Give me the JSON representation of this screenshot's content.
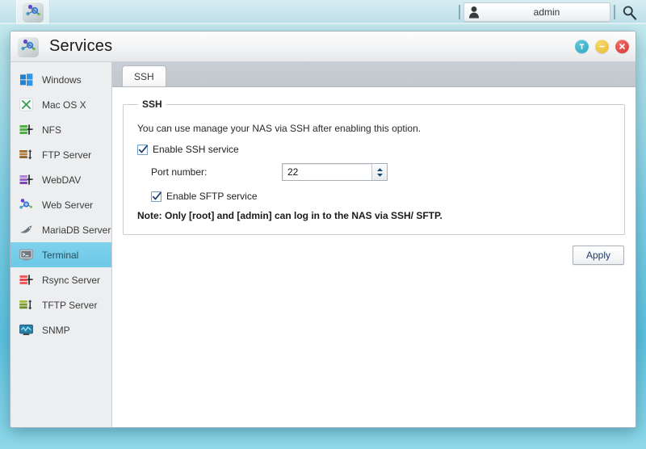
{
  "desktop": {
    "logo_icon": "molecule-logo-icon",
    "user": {
      "icon": "user-icon",
      "name": "admin"
    },
    "search_icon": "search-icon"
  },
  "window": {
    "title": "Services",
    "icon": "molecule-logo-icon",
    "controls": [
      {
        "name": "pin-button",
        "icon": "pin-icon",
        "color": "#29a9c4"
      },
      {
        "name": "minimize-button",
        "icon": "minus-icon",
        "color": "#e9bc2f"
      },
      {
        "name": "close-button",
        "icon": "close-icon",
        "color": "#d8352f"
      }
    ]
  },
  "sidebar": {
    "items": [
      {
        "label": "Windows",
        "icon": "windows-icon",
        "selected": false
      },
      {
        "label": "Mac OS X",
        "icon": "macosx-icon",
        "selected": false
      },
      {
        "label": "NFS",
        "icon": "nfs-icon",
        "selected": false
      },
      {
        "label": "FTP Server",
        "icon": "ftp-icon",
        "selected": false
      },
      {
        "label": "WebDAV",
        "icon": "webdav-icon",
        "selected": false
      },
      {
        "label": "Web Server",
        "icon": "webserver-icon",
        "selected": false
      },
      {
        "label": "MariaDB Server",
        "icon": "mariadb-icon",
        "selected": false
      },
      {
        "label": "Terminal",
        "icon": "terminal-icon",
        "selected": true
      },
      {
        "label": "Rsync Server",
        "icon": "rsync-icon",
        "selected": false
      },
      {
        "label": "TFTP Server",
        "icon": "tftp-icon",
        "selected": false
      },
      {
        "label": "SNMP",
        "icon": "snmp-icon",
        "selected": false
      }
    ]
  },
  "main": {
    "tabs": [
      {
        "label": "SSH",
        "active": true
      }
    ],
    "group": {
      "legend": "SSH",
      "description": "You can use manage your NAS via SSH after enabling this option.",
      "enable_ssh": {
        "label": "Enable SSH service",
        "checked": true
      },
      "port": {
        "label": "Port number:",
        "value": "22",
        "placeholder": ""
      },
      "enable_sftp": {
        "label": "Enable SFTP service",
        "checked": true
      },
      "note": "Note: Only [root] and [admin] can log in to the NAS via SSH/ SFTP."
    },
    "apply_label": "Apply"
  },
  "colors": {
    "selection": "#6cc9e8",
    "tabstrip": "#c5c9d0",
    "sidebar": "#eceef0",
    "accent_note": "#1a1a1a"
  }
}
